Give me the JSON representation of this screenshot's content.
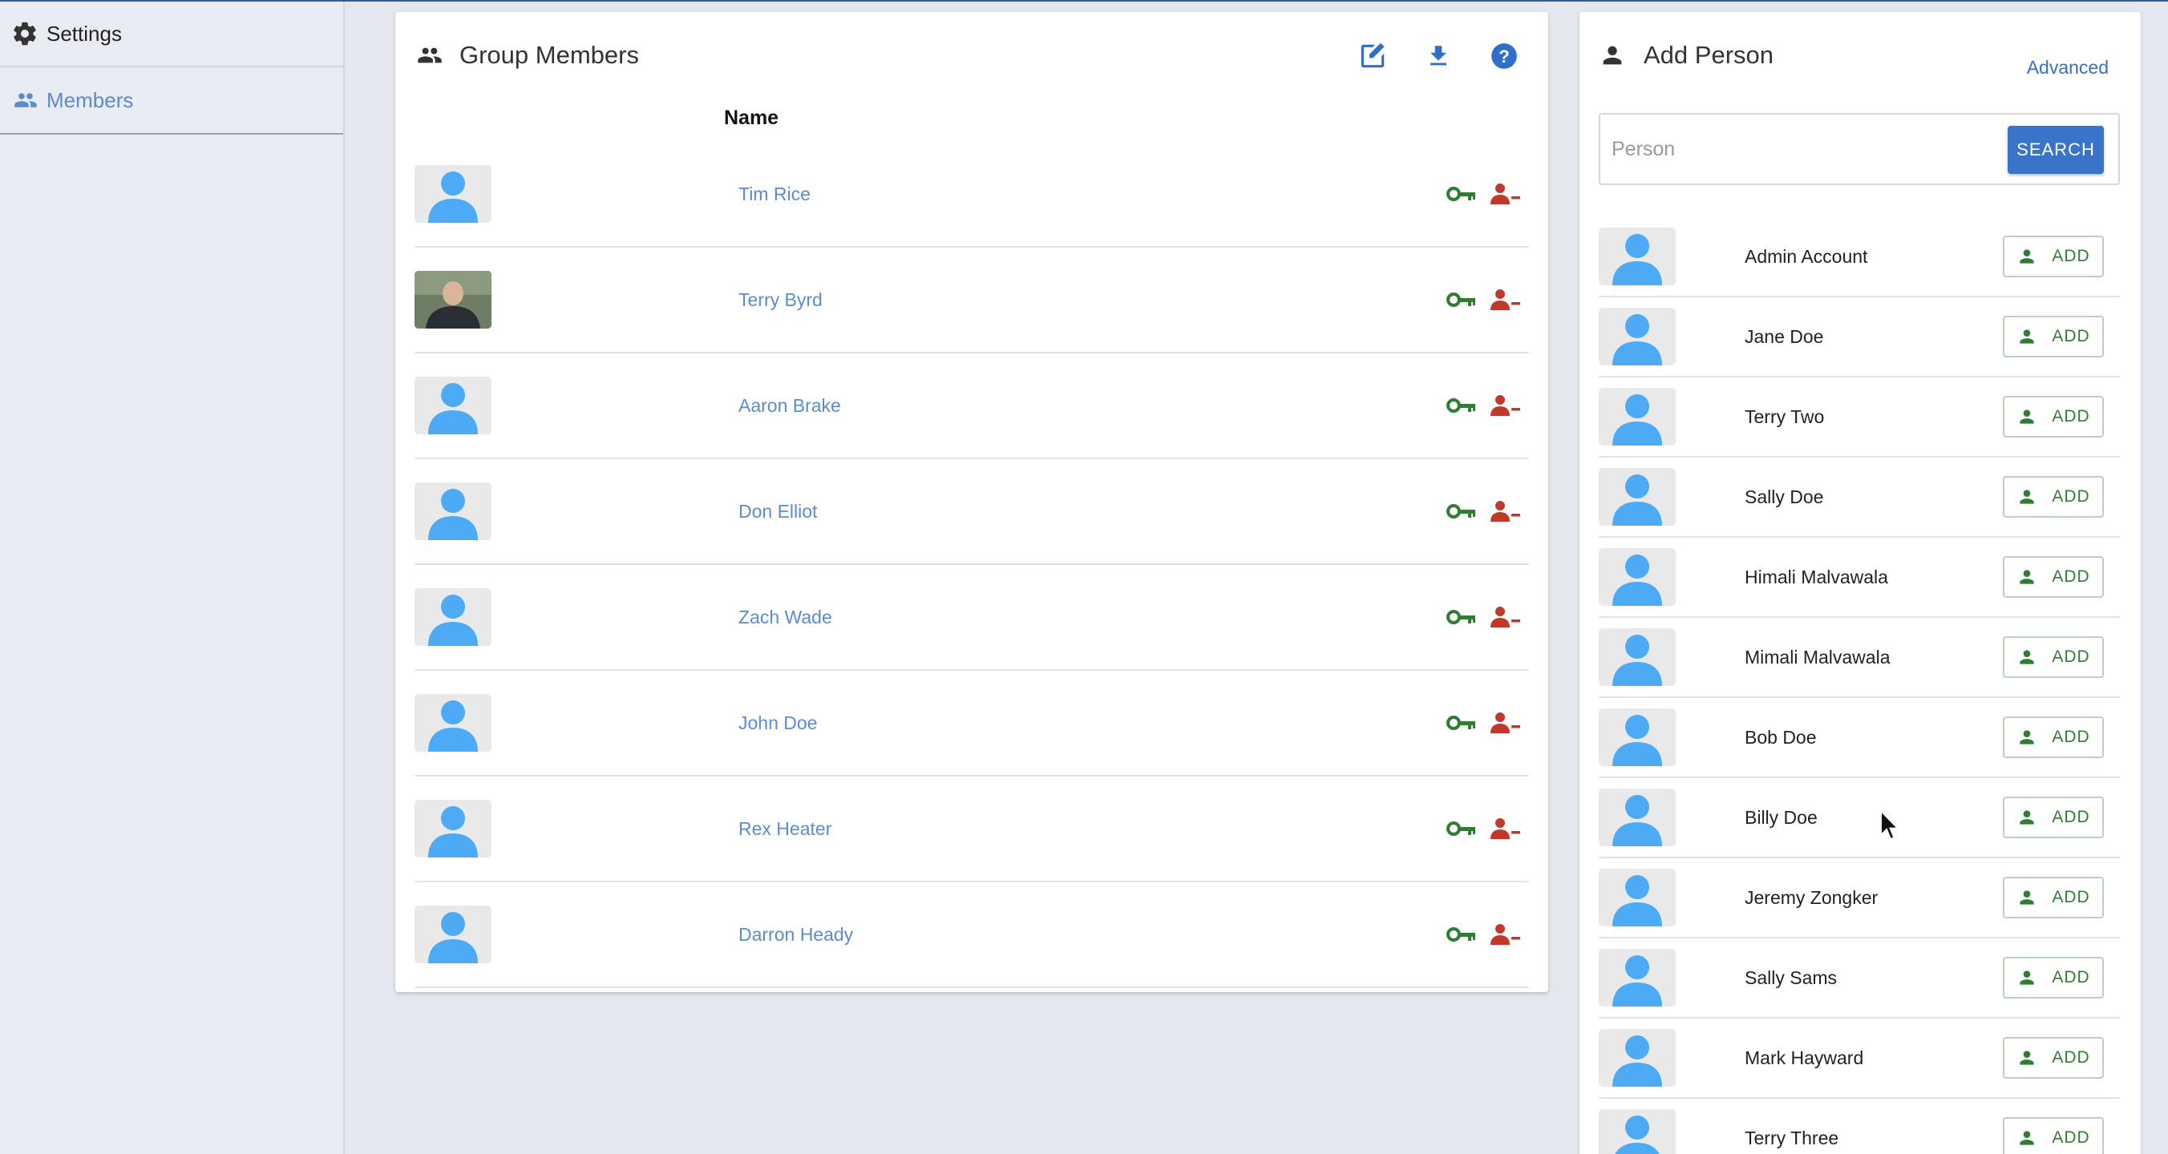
{
  "sidebar": {
    "items": [
      {
        "label": "Settings",
        "icon": "gear-icon"
      },
      {
        "label": "Members",
        "icon": "people-icon"
      }
    ]
  },
  "members_panel": {
    "title": "Group Members",
    "column_header": "Name",
    "tools": [
      "edit-icon",
      "download-icon",
      "help-icon"
    ],
    "members": [
      {
        "name": "Tim Rice",
        "photo": false
      },
      {
        "name": "Terry Byrd",
        "photo": true
      },
      {
        "name": "Aaron Brake",
        "photo": false
      },
      {
        "name": "Don Elliot",
        "photo": false
      },
      {
        "name": "Zach Wade",
        "photo": false
      },
      {
        "name": "John Doe",
        "photo": false
      },
      {
        "name": "Rex Heater",
        "photo": false
      },
      {
        "name": "Darron Heady",
        "photo": false
      }
    ]
  },
  "add_person_panel": {
    "title": "Add Person",
    "advanced_label": "Advanced",
    "search_placeholder": "Person",
    "search_value": "",
    "search_button": "SEARCH",
    "add_label": "ADD",
    "people": [
      "Admin Account",
      "Jane Doe",
      "Terry Two",
      "Sally Doe",
      "Himali Malvawala",
      "Mimali Malvawala",
      "Bob Doe",
      "Billy Doe",
      "Jeremy Zongker",
      "Sally Sams",
      "Mark Hayward",
      "Terry Three"
    ]
  },
  "colors": {
    "accent": "#3a74c9",
    "link": "#5b8ccd",
    "key_green": "#2e7d32",
    "remove_red": "#c0392b",
    "avatar_blue": "#4dabf5"
  }
}
